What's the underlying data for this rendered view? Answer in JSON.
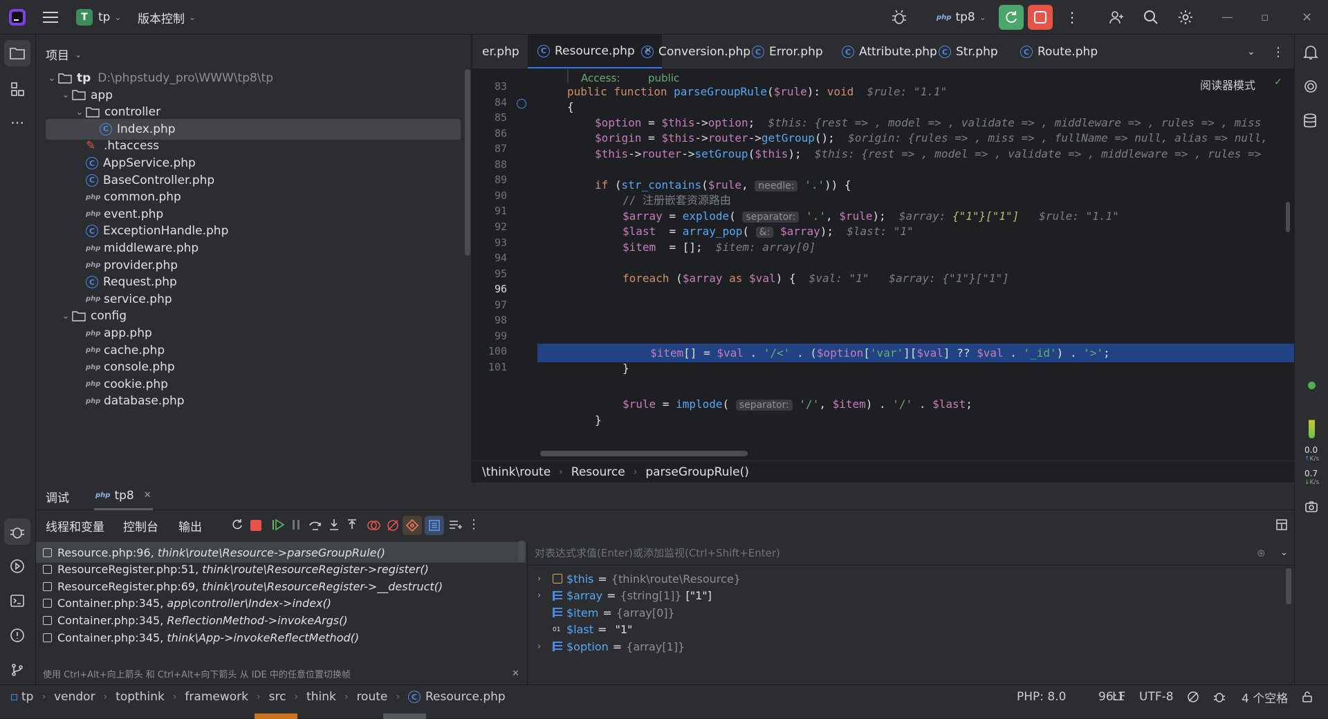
{
  "titlebar": {
    "project_badge": "T",
    "project": "tp",
    "vcs": "版本控制",
    "run_config": "tp8"
  },
  "project_panel": {
    "title": "项目",
    "tree": [
      {
        "label": "tp",
        "path": "D:\\phpstudy_pro\\WWW\\tp8\\tp",
        "type": "root"
      },
      {
        "label": "app",
        "type": "folder"
      },
      {
        "label": "controller",
        "type": "folder"
      },
      {
        "label": "Index.php",
        "type": "class"
      },
      {
        "label": ".htaccess",
        "type": "htaccess"
      },
      {
        "label": "AppService.php",
        "type": "class"
      },
      {
        "label": "BaseController.php",
        "type": "class"
      },
      {
        "label": "common.php",
        "type": "php"
      },
      {
        "label": "event.php",
        "type": "php"
      },
      {
        "label": "ExceptionHandle.php",
        "type": "class"
      },
      {
        "label": "middleware.php",
        "type": "php"
      },
      {
        "label": "provider.php",
        "type": "php"
      },
      {
        "label": "Request.php",
        "type": "class"
      },
      {
        "label": "service.php",
        "type": "php"
      },
      {
        "label": "config",
        "type": "folder"
      },
      {
        "label": "app.php",
        "type": "php"
      },
      {
        "label": "cache.php",
        "type": "php"
      },
      {
        "label": "console.php",
        "type": "php"
      },
      {
        "label": "cookie.php",
        "type": "php"
      },
      {
        "label": "database.php",
        "type": "php"
      }
    ]
  },
  "tabs": [
    {
      "label": "er.php"
    },
    {
      "label": "Resource.php",
      "active": true
    },
    {
      "label": "Conversion.php"
    },
    {
      "label": "Error.php"
    },
    {
      "label": "Attribute.php"
    },
    {
      "label": "Str.php"
    },
    {
      "label": "Route.php"
    }
  ],
  "editor": {
    "reader_mode": "阅读器模式",
    "access_label": "Access:",
    "access_value": "public",
    "lines": [
      "83",
      "84",
      "85",
      "86",
      "87",
      "88",
      "89",
      "90",
      "91",
      "92",
      "93",
      "94",
      "95",
      "96",
      "97",
      "98",
      "99",
      "100",
      "101"
    ],
    "current_line": "96"
  },
  "breadcrumb": [
    "\\think\\route",
    "Resource",
    "parseGroupRule()"
  ],
  "debug": {
    "tab_debug": "调试",
    "tab_session": "tp8",
    "subtabs": [
      "线程和变量",
      "控制台",
      "输出"
    ],
    "frames": [
      {
        "loc": "Resource.php:96,",
        "fn": "think\\route\\Resource->parseGroupRule()"
      },
      {
        "loc": "ResourceRegister.php:51,",
        "fn": "think\\route\\ResourceRegister->register()"
      },
      {
        "loc": "ResourceRegister.php:69,",
        "fn": "think\\route\\ResourceRegister->__destruct()"
      },
      {
        "loc": "Container.php:345,",
        "fn": "app\\controller\\Index->index()"
      },
      {
        "loc": "Container.php:345,",
        "fn": "ReflectionMethod->invokeArgs()"
      },
      {
        "loc": "Container.php:345,",
        "fn": "think\\App->invokeReflectMethod()"
      }
    ],
    "frames_hint": "使用 Ctrl+Alt+向上箭头 和 Ctrl+Alt+向下箭头 从 IDE 中的任意位置切换帧",
    "eval_placeholder": "对表达式求值(Enter)或添加监视(Ctrl+Shift+Enter)",
    "vars": [
      {
        "name": "$this",
        "eq": "=",
        "type": "{think\\route\\Resource}",
        "value": "",
        "expandable": true
      },
      {
        "name": "$array",
        "eq": "=",
        "type": "{string[1]}",
        "value": "[\"1\"]",
        "expandable": true
      },
      {
        "name": "$item",
        "eq": "=",
        "type": "{array[0]}",
        "value": "",
        "expandable": false
      },
      {
        "name": "$last",
        "eq": "=",
        "type": "",
        "value": "\"1\"",
        "expandable": false
      },
      {
        "name": "$option",
        "eq": "=",
        "type": "{array[1]}",
        "value": "",
        "expandable": true
      }
    ]
  },
  "status": {
    "path": [
      "tp",
      "vendor",
      "topthink",
      "framework",
      "src",
      "think",
      "route",
      "Resource.php"
    ],
    "php": "PHP: 8.0",
    "pos": "96:1",
    "eol": "LF",
    "enc": "UTF-8",
    "indent": "4 个空格"
  },
  "net": {
    "up": "0.0",
    "down": "0.7",
    "unit": "K/s"
  },
  "colors": {
    "accent": "#3574f0",
    "selection": "#214283",
    "stop": "#e5534b",
    "run": "#4aa66b"
  }
}
